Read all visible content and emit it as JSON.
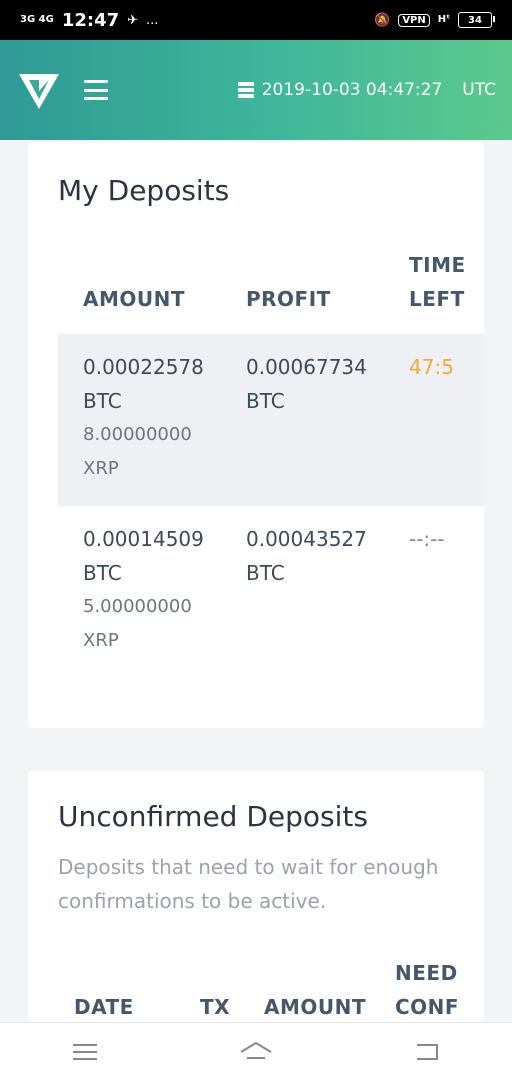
{
  "status_bar": {
    "network": "3G 4G",
    "time": "12:47",
    "extra": "...",
    "vpn": "VPN",
    "signal": "Hᵗ",
    "battery": "34"
  },
  "header": {
    "datetime": "2019-10-03 04:47:27",
    "timezone": "UTC"
  },
  "deposits": {
    "title": "My Deposits",
    "columns": {
      "amount": "AMOUNT",
      "profit": "PROFIT",
      "time_left_1": "TIME",
      "time_left_2": "LEFT"
    },
    "rows": [
      {
        "amount_btc": "0.00022578",
        "amount_unit": "BTC",
        "amount_xrp": "8.00000000",
        "xrp_unit": "XRP",
        "profit": "0.00067734",
        "profit_unit": "BTC",
        "time_left": "47:5"
      },
      {
        "amount_btc": "0.00014509",
        "amount_unit": "BTC",
        "amount_xrp": "5.00000000",
        "xrp_unit": "XRP",
        "profit": "0.00043527",
        "profit_unit": "BTC",
        "time_left": "--:--"
      }
    ],
    "timer_color_active": "#f0a93a",
    "timer_color_inactive": "#7a8490"
  },
  "unconfirmed": {
    "title": "Unconfirmed Deposits",
    "subtitle": "Deposits that need to wait for enough confirmations to be active.",
    "columns": {
      "date": "DATE",
      "tx": "TX",
      "amount": "AMOUNT",
      "need_1": "NEED",
      "need_2": "CONF"
    }
  },
  "colors": {
    "accent_start": "#2f9a96",
    "accent_end": "#5cc98c"
  }
}
